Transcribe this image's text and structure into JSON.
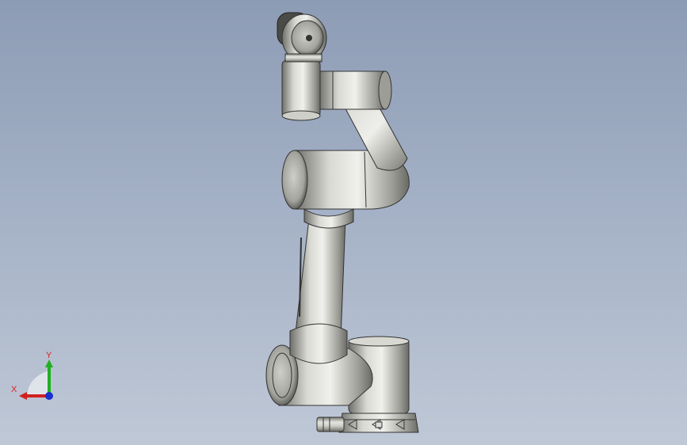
{
  "viewport": {
    "background_top": "#8d9cb5",
    "background_bottom": "#bfc8d6",
    "model_name": "",
    "model_color": "#b9b9b4"
  },
  "triad": {
    "x_label": "X",
    "y_label": "Y",
    "x_color": "#d22020",
    "y_color": "#1fb020",
    "z_color": "#1a2fd0"
  }
}
